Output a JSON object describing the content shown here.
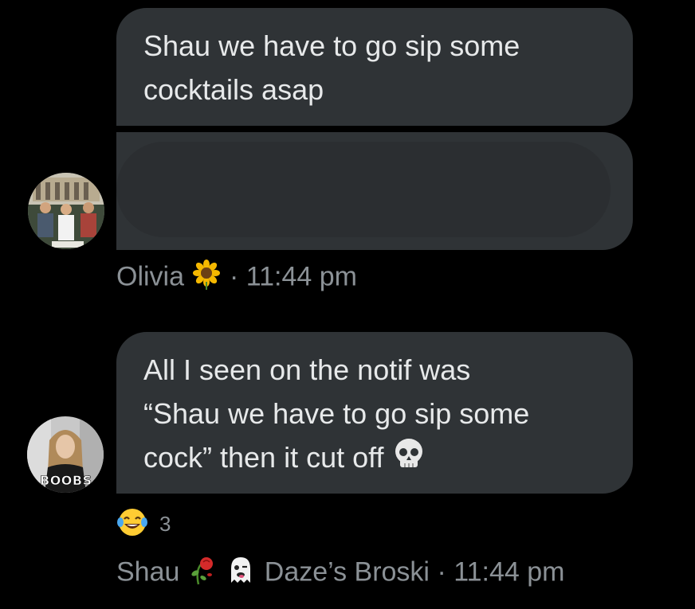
{
  "messages": [
    {
      "text": "Shau we have to go sip some\ncocktails asap",
      "sender": "Olivia",
      "sender_emoji": "sunflower-emoji",
      "time": "11:44 pm"
    },
    {
      "text": "All I seen on the notif was\n“Shau we have to go sip some\ncock” then it cut off",
      "trailing_emoji": "skull-emoji",
      "reaction": {
        "emoji": "face-with-tears-of-joy",
        "count": "3"
      },
      "sender": "Shau",
      "sender_emojis": [
        "wilted-rose-emoji",
        "ghost-emoji"
      ],
      "sender_suffix": "Daze’s Broski",
      "time": "11:44 pm"
    }
  ],
  "avatars": {
    "shau_badge_text": "BOOBS"
  },
  "colors": {
    "background": "#000000",
    "bubble": "#2f3336",
    "text": "#e7e9ea",
    "meta_text": "#8b9196"
  },
  "separator": "·"
}
